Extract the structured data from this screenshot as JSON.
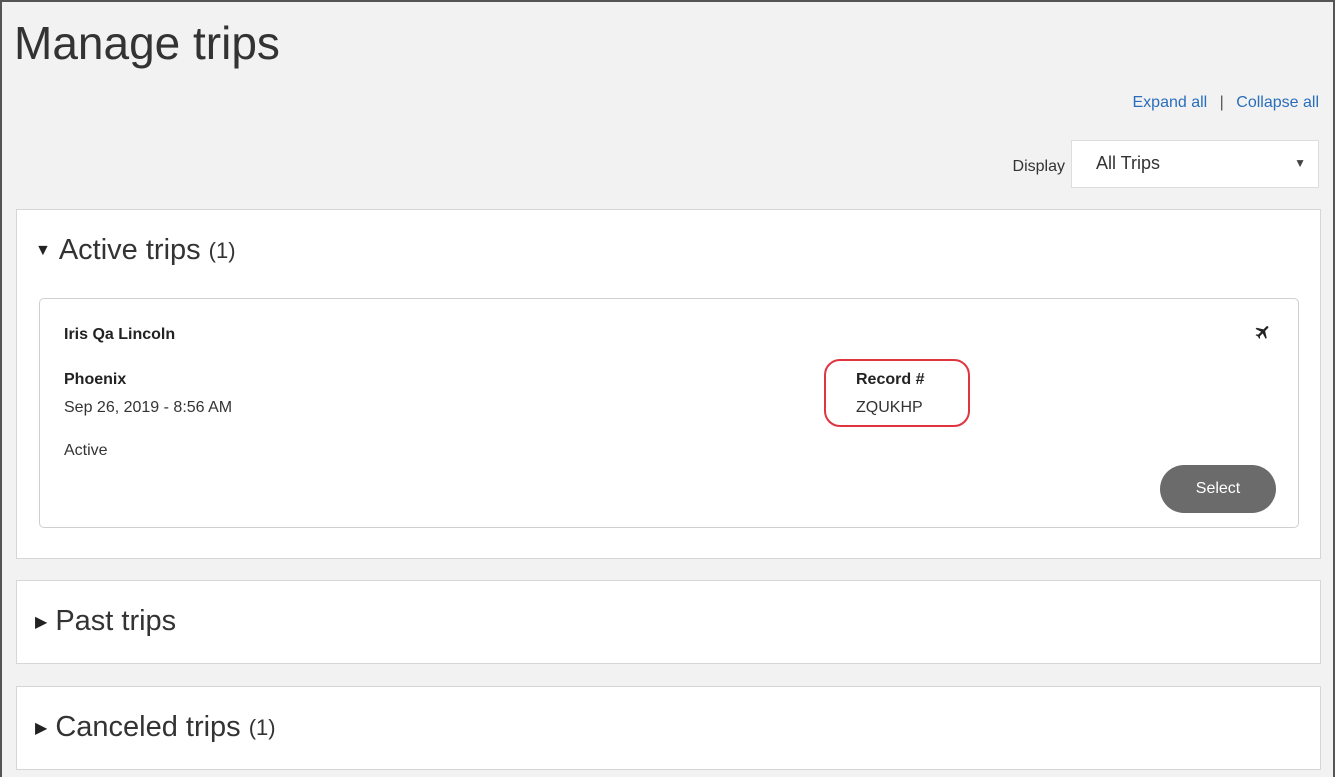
{
  "page": {
    "title": "Manage trips"
  },
  "controls": {
    "expand_all": "Expand all",
    "separator": "|",
    "collapse_all": "Collapse all",
    "display_label": "Display",
    "display_value": "All Trips",
    "display_caret": "▼"
  },
  "sections": {
    "active": {
      "label": "Active trips",
      "count": "(1)",
      "expanded": true,
      "trip": {
        "traveler": "Iris Qa Lincoln",
        "destination": "Phoenix",
        "datetime": "Sep 26, 2019 - 8:56 AM",
        "status": "Active",
        "record_label": "Record #",
        "record_value": "ZQUKHP",
        "icon": "airplane-icon",
        "select_label": "Select"
      }
    },
    "past": {
      "label": "Past trips",
      "count": "",
      "expanded": false
    },
    "canceled": {
      "label": "Canceled trips",
      "count": "(1)",
      "expanded": false
    }
  },
  "colors": {
    "link": "#2a6ebb",
    "highlight": "#e0343f",
    "button_bg": "#6b6b6b",
    "page_bg": "#f2f2f2"
  }
}
